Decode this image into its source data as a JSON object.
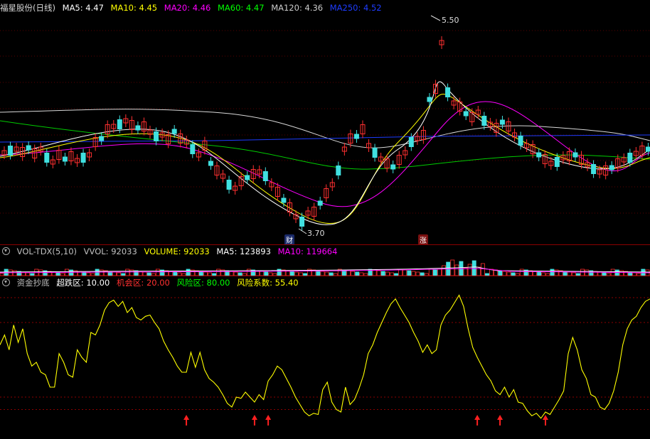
{
  "main": {
    "stock_title": "福星股份(日线)",
    "ma_labels": [
      {
        "text": "MA5: 4.47",
        "color": "#ffffff"
      },
      {
        "text": "MA10: 4.45",
        "color": "#ffff00"
      },
      {
        "text": "MA20: 4.46",
        "color": "#ff00ff"
      },
      {
        "text": "MA60: 4.47",
        "color": "#00ff00"
      },
      {
        "text": "MA120: 4.36",
        "color": "#cccccc"
      },
      {
        "text": "MA250: 4.52",
        "color": "#1e3cff"
      }
    ],
    "high_label": "5.50",
    "low_label": "3.70",
    "badge_cai": "财",
    "badge_zhang": "涨"
  },
  "volume": {
    "labels": [
      {
        "text": "VOL-TDX(5,10)",
        "color": "#c0c0c0"
      },
      {
        "text": "VVOL: 92033",
        "color": "#c0c0c0"
      },
      {
        "text": "VOLUME: 92033",
        "color": "#ffff00"
      },
      {
        "text": "MA5: 123893",
        "color": "#ffffff"
      },
      {
        "text": "MA10: 119664",
        "color": "#ff00ff"
      }
    ]
  },
  "indicator": {
    "labels": [
      {
        "text": "资金抄底",
        "color": "#c0c0c0"
      },
      {
        "text": "超跌区: 10.00",
        "color": "#ffffff"
      },
      {
        "text": "机会区: 20.00",
        "color": "#ff3030"
      },
      {
        "text": "风险区: 80.00",
        "color": "#00ff00"
      },
      {
        "text": "风险系数: 55.40",
        "color": "#ffff00"
      }
    ],
    "series": [
      62,
      70,
      58,
      78,
      64,
      75,
      55,
      45,
      48,
      40,
      38,
      28,
      28,
      55,
      48,
      38,
      36,
      58,
      52,
      48,
      72,
      70,
      78,
      90,
      96,
      98,
      93,
      97,
      88,
      92,
      84,
      82,
      85,
      86,
      80,
      75,
      65,
      58,
      52,
      45,
      40,
      40,
      56,
      44,
      56,
      42,
      35,
      32,
      28,
      22,
      15,
      12,
      20,
      19,
      24,
      20,
      16,
      22,
      18,
      33,
      38,
      45,
      42,
      35,
      28,
      20,
      14,
      8,
      5,
      7,
      6,
      26,
      32,
      16,
      10,
      8,
      28,
      14,
      18,
      27,
      38,
      55,
      62,
      72,
      80,
      88,
      95,
      99,
      92,
      86,
      80,
      72,
      65,
      56,
      62,
      55,
      58,
      78,
      86,
      90,
      96,
      102,
      93,
      75,
      60,
      52,
      45,
      38,
      33,
      25,
      22,
      28,
      20,
      26,
      16,
      15,
      9,
      5,
      7,
      3,
      8,
      6,
      12,
      18,
      25,
      55,
      68,
      58,
      42,
      35,
      22,
      20,
      12,
      10,
      15,
      25,
      40,
      62,
      75,
      82,
      85,
      92,
      97,
      99
    ],
    "arrow_indices": [
      41,
      56,
      59,
      105,
      110,
      120
    ]
  }
}
